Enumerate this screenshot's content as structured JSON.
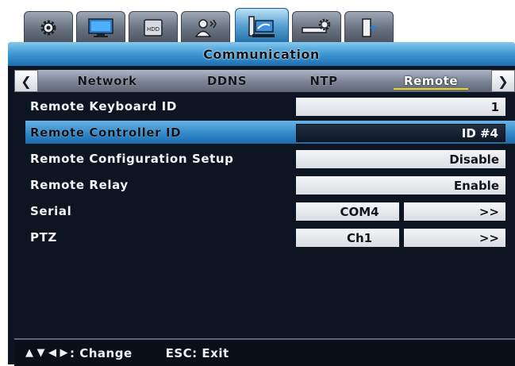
{
  "icon_tabs": [
    {
      "icon": "gear-icon",
      "active": false
    },
    {
      "icon": "monitor-icon",
      "active": false
    },
    {
      "icon": "hdd-icon",
      "label": "HDD",
      "active": false
    },
    {
      "icon": "user-icon",
      "active": false
    },
    {
      "icon": "network-communication-icon",
      "active": true
    },
    {
      "icon": "device-settings-icon",
      "active": false
    },
    {
      "icon": "exit-door-icon",
      "active": false
    }
  ],
  "title": "Communication",
  "subtabs": [
    {
      "label": "Network",
      "active": false
    },
    {
      "label": "DDNS",
      "active": false
    },
    {
      "label": "NTP",
      "active": false
    },
    {
      "label": "Remote",
      "active": true
    }
  ],
  "rows": [
    {
      "label": "Remote Keyboard ID",
      "value": "1"
    },
    {
      "label": "Remote Controller ID",
      "value": "ID #4",
      "selected": true
    },
    {
      "label": "Remote Configuration Setup",
      "value": "Disable"
    },
    {
      "label": "Remote Relay",
      "value": "Enable"
    },
    {
      "label": "Serial",
      "value": "COM4",
      "action": ">>"
    },
    {
      "label": "PTZ",
      "value": "Ch1",
      "action": ">>"
    }
  ],
  "help": {
    "change": ": Change",
    "exit": "ESC: Exit"
  },
  "colors": {
    "accent_blue": "#2e86c7",
    "background": "#0d1422",
    "underline": "#f1d21a"
  }
}
